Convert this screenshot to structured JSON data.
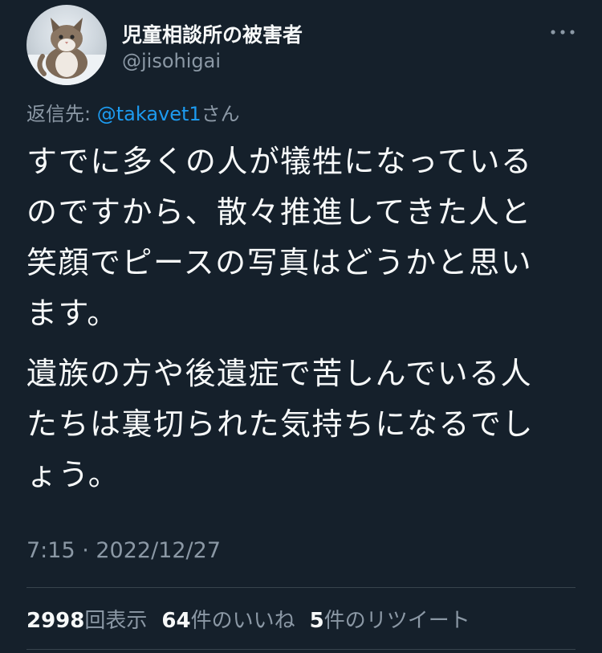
{
  "author": {
    "display_name": "児童相談所の被害者",
    "handle": "@jisohigai",
    "avatar_icon": "cat-photo-avatar"
  },
  "more_icon": "more-horizontal-icon",
  "reply": {
    "prefix": "返信先: ",
    "mention": "@takavet1",
    "suffix": "さん"
  },
  "body": {
    "lines": [
      "すでに多くの人が犠牲になっている",
      "のですから、散々推進してきた人と",
      "笑顔でピースの写真はどうかと思い",
      "ます。",
      "遺族の方や後遺症で苦しんでいる人",
      "たちは裏切られた気持ちになるでし",
      "ょう。"
    ]
  },
  "timestamp": "7:15 · 2022/12/27",
  "stats": {
    "views_count": "2998",
    "views_label": "回表示",
    "likes_count": "64",
    "likes_label": "件のいいね",
    "retweets_count": "5",
    "retweets_label": "件のリツイート"
  },
  "colors": {
    "background": "#15202b",
    "text": "#f7f9f9",
    "secondary": "#8b98a5",
    "accent": "#1d9bf0",
    "divider": "#38444d"
  }
}
